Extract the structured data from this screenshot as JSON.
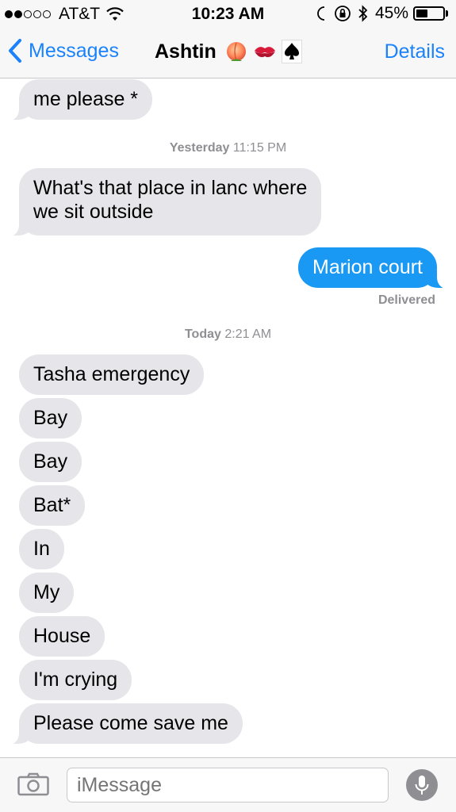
{
  "status_bar": {
    "carrier": "AT&T",
    "time": "10:23 AM",
    "battery_percent": "45%",
    "battery_level": 0.45,
    "signal_bars": 2
  },
  "nav": {
    "back_label": "Messages",
    "contact_name": "Ashtin",
    "details_label": "Details"
  },
  "messages": [
    {
      "from": "them",
      "text": "me please *"
    },
    {
      "from": "them",
      "text": "What's that place in lanc where"
    },
    {
      "from": "them",
      "text": "we sit outside"
    },
    {
      "from": "me",
      "text": "Marion court"
    },
    {
      "from": "them",
      "text": "Tasha emergency"
    },
    {
      "from": "them",
      "text": "Bay"
    },
    {
      "from": "them",
      "text": "Bay"
    },
    {
      "from": "them",
      "text": "Bat*"
    },
    {
      "from": "them",
      "text": "In"
    },
    {
      "from": "them",
      "text": "My"
    },
    {
      "from": "them",
      "text": "House"
    },
    {
      "from": "them",
      "text": "I'm crying"
    },
    {
      "from": "them",
      "text": "Please come save me"
    }
  ],
  "timestamps": [
    {
      "day": "Yesterday",
      "time": "11:15 PM"
    },
    {
      "day": "Today",
      "time": "2:21 AM"
    }
  ],
  "delivery_status": "Delivered",
  "composer": {
    "placeholder": "iMessage"
  },
  "colors": {
    "accent": "#1a82fb",
    "outgoing_bubble": "#1a99f4",
    "incoming_bubble": "#e5e5ea"
  },
  "icons": [
    "signal-dots-icon",
    "wifi-icon",
    "moon-icon",
    "rotation-lock-icon",
    "bluetooth-icon",
    "battery-icon",
    "back-chevron-icon",
    "peach-emoji-icon",
    "kiss-emoji-icon",
    "spade-emoji-icon",
    "camera-icon",
    "microphone-icon"
  ]
}
